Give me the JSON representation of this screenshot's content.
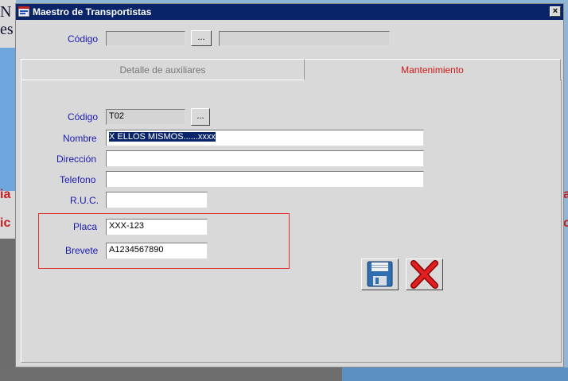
{
  "window": {
    "title": "Maestro de Transportistas",
    "close_label": "×"
  },
  "header": {
    "codigo_label": "Código",
    "codigo_value": "",
    "browse_label": "...",
    "descripcion_value": ""
  },
  "tabs": [
    {
      "label": "Detalle de auxiliares",
      "active": false
    },
    {
      "label": "Mantenimiento",
      "active": true
    }
  ],
  "form": {
    "codigo": {
      "label": "Código",
      "value": "T02",
      "browse_label": "..."
    },
    "nombre": {
      "label": "Nombre",
      "value": "X ELLOS MISMOS......xxxx"
    },
    "direccion": {
      "label": "Dirección",
      "value": ""
    },
    "telefono": {
      "label": "Telefono",
      "value": ""
    },
    "ruc": {
      "label": "R.U.C.",
      "value": ""
    },
    "placa": {
      "label": "Placa",
      "value": "XXX-123"
    },
    "brevete": {
      "label": "Brevete",
      "value": "A1234567890"
    }
  },
  "actions": {
    "save_icon": "floppy-disk-icon",
    "cancel_icon": "red-x-icon"
  },
  "colors": {
    "title_bar": "#0a246a",
    "label_blue": "#1a1ab0",
    "active_tab": "#d01818",
    "group_border": "#e03030"
  },
  "background": {
    "text_fragments": [
      "N",
      "es",
      "ia",
      "ic",
      "a",
      "c"
    ]
  }
}
